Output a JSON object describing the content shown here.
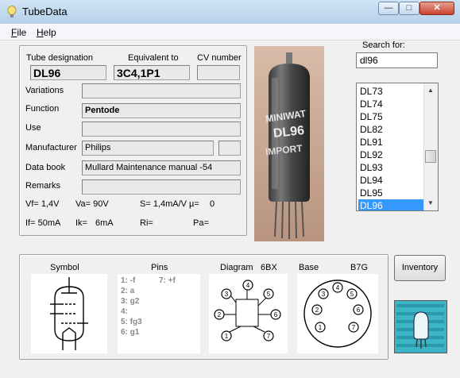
{
  "window": {
    "title": "TubeData",
    "minimize": "—",
    "maximize": "□",
    "close": "✕"
  },
  "menu": {
    "file": "File",
    "file_key": "F",
    "file_rest": "ile",
    "help": "Help",
    "help_key": "H",
    "help_rest": "elp"
  },
  "main": {
    "labels": {
      "designation": "Tube designation",
      "equivalent": "Equivalent to",
      "cv": "CV number",
      "variations": "Variations",
      "function": "Function",
      "use": "Use",
      "manufacturer": "Manufacturer",
      "databook": "Data book",
      "remarks": "Remarks"
    },
    "values": {
      "designation": "DL96",
      "equivalent": "3C4,1P1",
      "cv": "",
      "variations": "",
      "function": "Pentode",
      "use": "",
      "manufacturer": "Philips",
      "manufacturer_extra": "",
      "databook": "Mullard Maintenance manual -54",
      "remarks": ""
    },
    "params": {
      "vf": "Vf= 1,4V",
      "va": "Va=  90V",
      "s": "S= 1,4mA/V",
      "mu": "µ=",
      "mu_val": "0",
      "if": "If= 50mA",
      "ik": "Ik=",
      "ik_val": "6mA",
      "ri": "Ri=",
      "pa": "Pa="
    }
  },
  "search": {
    "label": "Search for:",
    "value": "dl96"
  },
  "tube_list": {
    "items": [
      "DL73",
      "DL74",
      "DL75",
      "DL82",
      "DL91",
      "DL92",
      "DL93",
      "DL94",
      "DL95",
      "DL96"
    ],
    "selected": "DL96"
  },
  "bottom": {
    "symbol_label": "Symbol",
    "pins_label": "Pins",
    "diagram_label": "Diagram",
    "diagram_code": "6BX",
    "base_label": "Base",
    "base_code": "B7G",
    "pins_left": [
      "1: -f",
      "2: a",
      "3: g2",
      "4:",
      "5: fg3",
      "6: g1"
    ],
    "pins_right": [
      "7: +f"
    ],
    "diagram_pins": [
      "1",
      "2",
      "3",
      "4",
      "5",
      "6",
      "7"
    ],
    "base_pins": [
      "1",
      "2",
      "3",
      "4",
      "5",
      "6",
      "7"
    ]
  },
  "inventory_button": "Inventory",
  "photo_text": {
    "line1": "MINIWAT",
    "line2": "DL96",
    "line3": "IMPORT"
  },
  "colors": {
    "selection": "#3399ff",
    "titlebar": "#b6d1ea"
  }
}
